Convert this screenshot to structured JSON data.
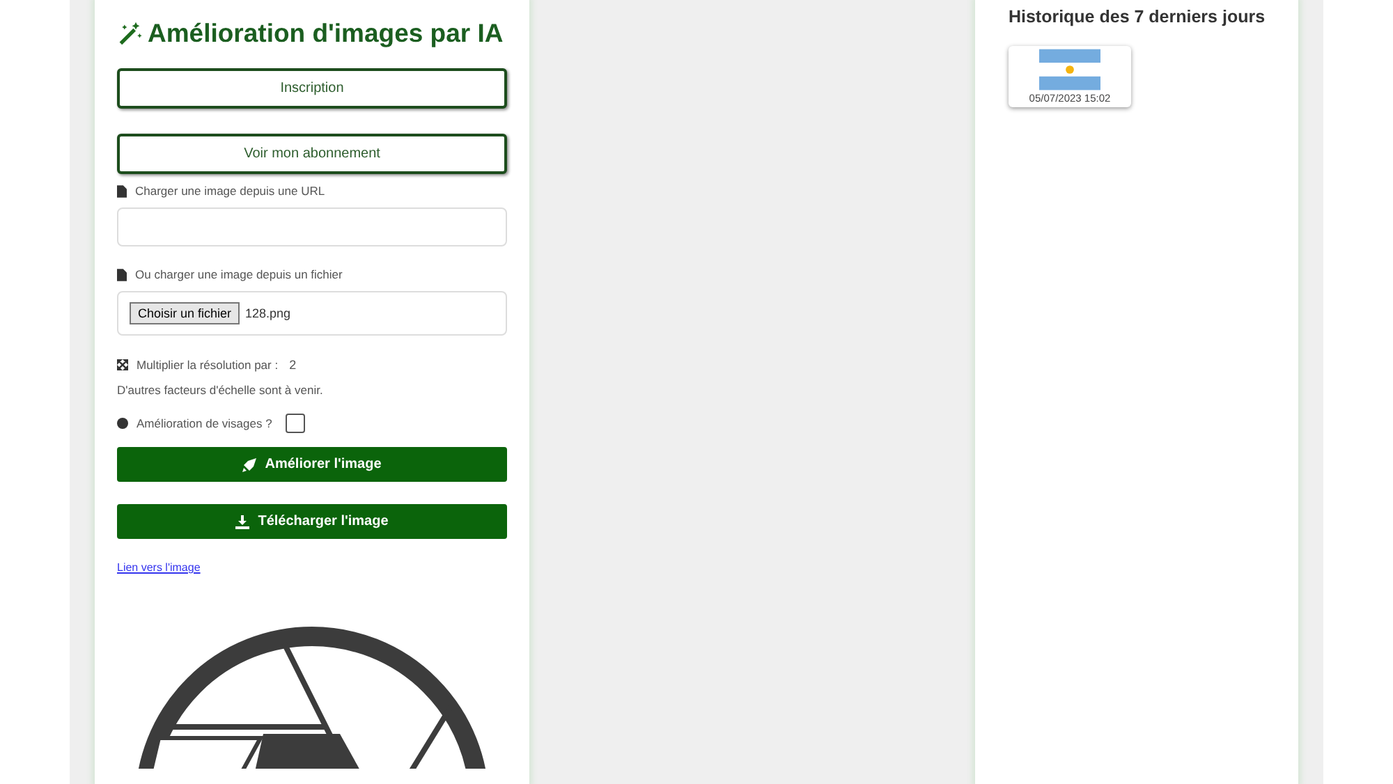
{
  "app": {
    "title": "Amélioration d'images par IA"
  },
  "buttons": [
    {
      "label": "Inscription"
    },
    {
      "label": "Voir mon abonnement"
    }
  ],
  "url_field": {
    "label": "Charger une image depuis une URL"
  },
  "file_field": {
    "label": "Ou charger une image depuis un fichier",
    "button": "Choisir un fichier",
    "value": "128.png"
  },
  "scale": {
    "label": "Multiplier la résolution par :",
    "value": "2",
    "note": "D'autres facteurs d'échelle sont à venir."
  },
  "face_option": {
    "label": "Amélioration de visages ?",
    "checked": false
  },
  "actions": [
    {
      "kind": "enhance",
      "label": "Améliorer l'image"
    },
    {
      "kind": "download",
      "label": "Télécharger l'image"
    }
  ],
  "link": "Lien vers l'image",
  "history": {
    "title": "Historique des 7 derniers jours",
    "items": [
      {
        "date": "05/07/2023 15:02"
      }
    ]
  }
}
